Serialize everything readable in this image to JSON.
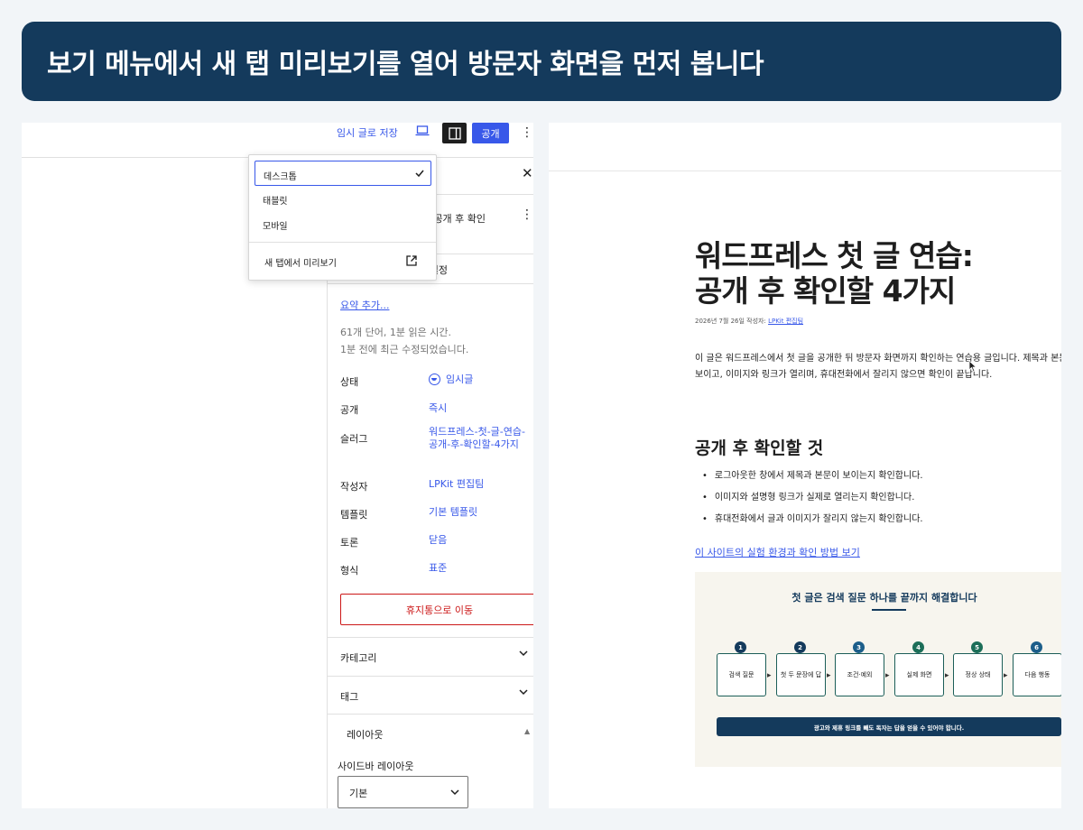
{
  "banner": {
    "title": "보기 메뉴에서 새 탭 미리보기를 열어 방문자 화면을 먼저 봅니다"
  },
  "editor": {
    "toolbar": {
      "save_draft": "임시 글로 저장",
      "publish": "공개"
    },
    "preview_menu": {
      "items": [
        "데스크톱",
        "태블릿",
        "모바일"
      ],
      "selected": "데스크톱",
      "new_tab": "새 탭에서 미리보기"
    },
    "sidebar": {
      "post_title": "연습: 공개 후 확인",
      "featured_image": "미지 설정",
      "excerpt_link": "요약 추가...",
      "word_count": "61개 단어, 1분 읽은 시간.",
      "last_edited": "1분 전에 최근 수정되었습니다.",
      "rows": [
        {
          "label": "상태",
          "value": "임시글"
        },
        {
          "label": "공개",
          "value": "즉시"
        },
        {
          "label": "슬러그",
          "value": "워드프레스-첫-글-연습-공개-후-확인할-4가지"
        },
        {
          "label": "작성자",
          "value": "LPKit 편집팀"
        },
        {
          "label": "템플릿",
          "value": "기본 템플릿"
        },
        {
          "label": "토론",
          "value": "닫음"
        },
        {
          "label": "형식",
          "value": "표준"
        }
      ],
      "trash": "휴지통으로 이동",
      "panels": [
        "카테고리",
        "태그"
      ],
      "layout_panel": "레이아웃",
      "sidebar_layout_label": "사이드바 레이아웃",
      "sidebar_layout_value": "기본"
    }
  },
  "preview": {
    "title_line1": "워드프레스 첫 글 연습:",
    "title_line2": "공개 후 확인할 4가지",
    "meta_prefix": "2026년 7월 26일 작성자: ",
    "meta_author": "LPKit 편집팀",
    "para_line1": "이 글은 워드프레스에서 첫 글을 공개한 뒤 방문자 화면까지 확인하는 연습용 글입니다. 제목과 본문",
    "para_line2": "보이고, 이미지와 링크가 열리며, 휴대전화에서 잘리지 않으면 확인이 끝납니다.",
    "heading": "공개 후 확인할 것",
    "checklist": [
      "로그아웃한 창에서 제목과 본문이 보이는지 확인합니다.",
      "이미지와 설명형 링크가 실제로 열리는지 확인합니다.",
      "휴대전화에서 글과 이미지가 잘리지 않는지 확인합니다."
    ],
    "link": "이 사이트의 실험 환경과 확인 방법 보기",
    "figure": {
      "title": "첫 글은 검색 질문 하나를 끝까지 해결합니다",
      "steps": [
        {
          "num": "1",
          "label": "검색 질문",
          "color": "#143a5c"
        },
        {
          "num": "2",
          "label": "첫 두 문장에 답",
          "color": "#143a5c"
        },
        {
          "num": "3",
          "label": "조건·예외",
          "color": "#1c5e8a"
        },
        {
          "num": "4",
          "label": "실제 화면",
          "color": "#1c6e58"
        },
        {
          "num": "5",
          "label": "정상 상태",
          "color": "#1c6e58"
        },
        {
          "num": "6",
          "label": "다음 행동",
          "color": "#1c5e8a"
        }
      ],
      "footer": "광고와 제휴 링크를 빼도 독자는 답을 얻을 수 있어야 합니다."
    }
  }
}
